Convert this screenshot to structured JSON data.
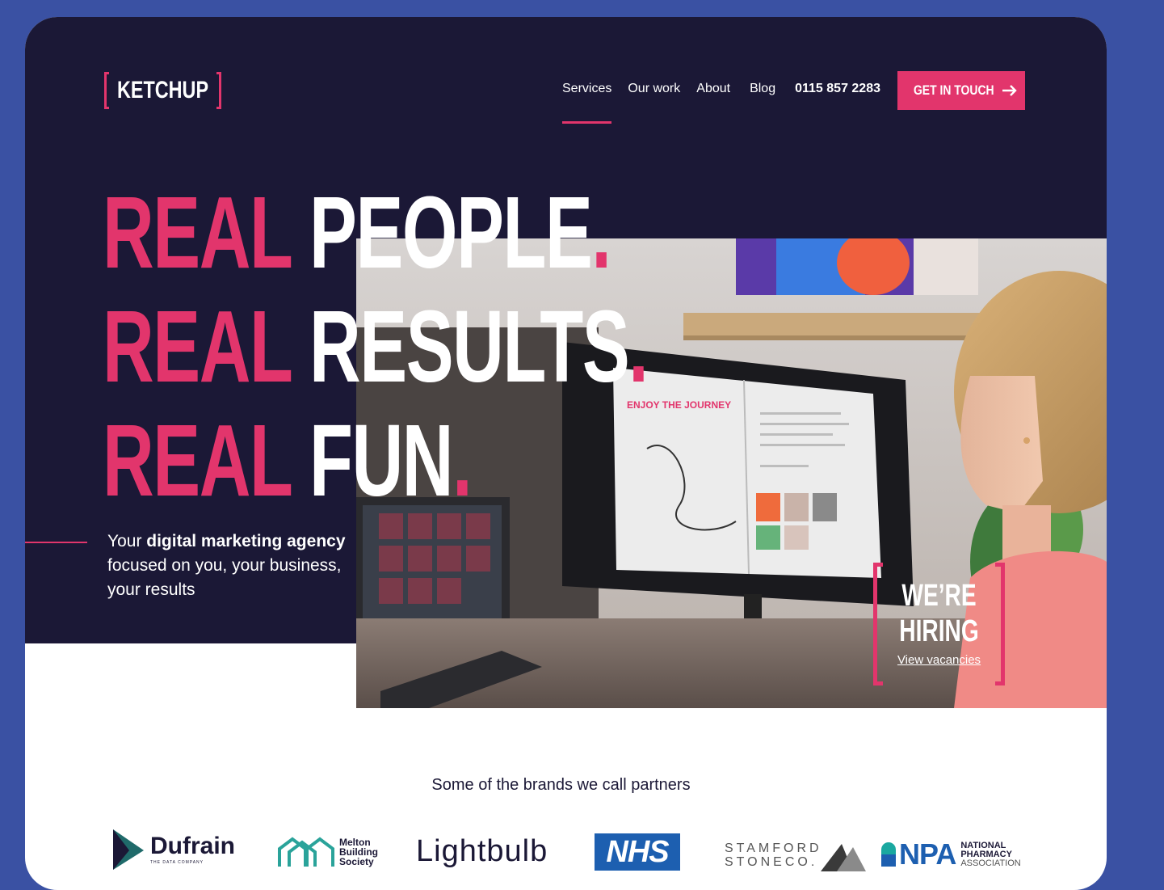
{
  "header": {
    "logo_text": "KETCHUP",
    "nav": [
      {
        "label": "Services"
      },
      {
        "label": "Our work"
      },
      {
        "label": "About"
      },
      {
        "label": "Blog"
      }
    ],
    "phone": "0115 857 2283",
    "cta_label": "GET IN TOUCH"
  },
  "hero": {
    "lines": [
      {
        "accent": "REAL",
        "rest": "PEOPLE",
        "dot": "."
      },
      {
        "accent": "REAL",
        "rest": "RESULTS",
        "dot": "."
      },
      {
        "accent": "REAL",
        "rest": "FUN",
        "dot": "."
      }
    ],
    "intro_prefix": "Your ",
    "intro_bold": "digital marketing agency",
    "intro_rest": " focused on you, your business, your results",
    "hiring_line1": "WE’RE",
    "hiring_line2": "HIRING",
    "hiring_link": "View vacancies"
  },
  "partners": {
    "title": "Some of the brands we call partners",
    "brands": [
      {
        "name": "Dufrain",
        "tagline": "THE DATA COMPANY"
      },
      {
        "name": "Melton Building Society",
        "l1": "Melton",
        "l2": "Building",
        "l3": "Society"
      },
      {
        "name": "Lightbulb"
      },
      {
        "name": "NHS"
      },
      {
        "name": "Stamford Stone Co",
        "l1": "STAMFORD",
        "l2": "STONECO."
      },
      {
        "name": "NPA",
        "l1": "NATIONAL",
        "l2": "PHARMACY",
        "l3": "ASSOCIATION"
      }
    ]
  },
  "colors": {
    "page_bg": "#3a51a3",
    "hero_bg": "#1b1836",
    "accent": "#e2356c",
    "nhs_blue": "#1d5fb0"
  }
}
